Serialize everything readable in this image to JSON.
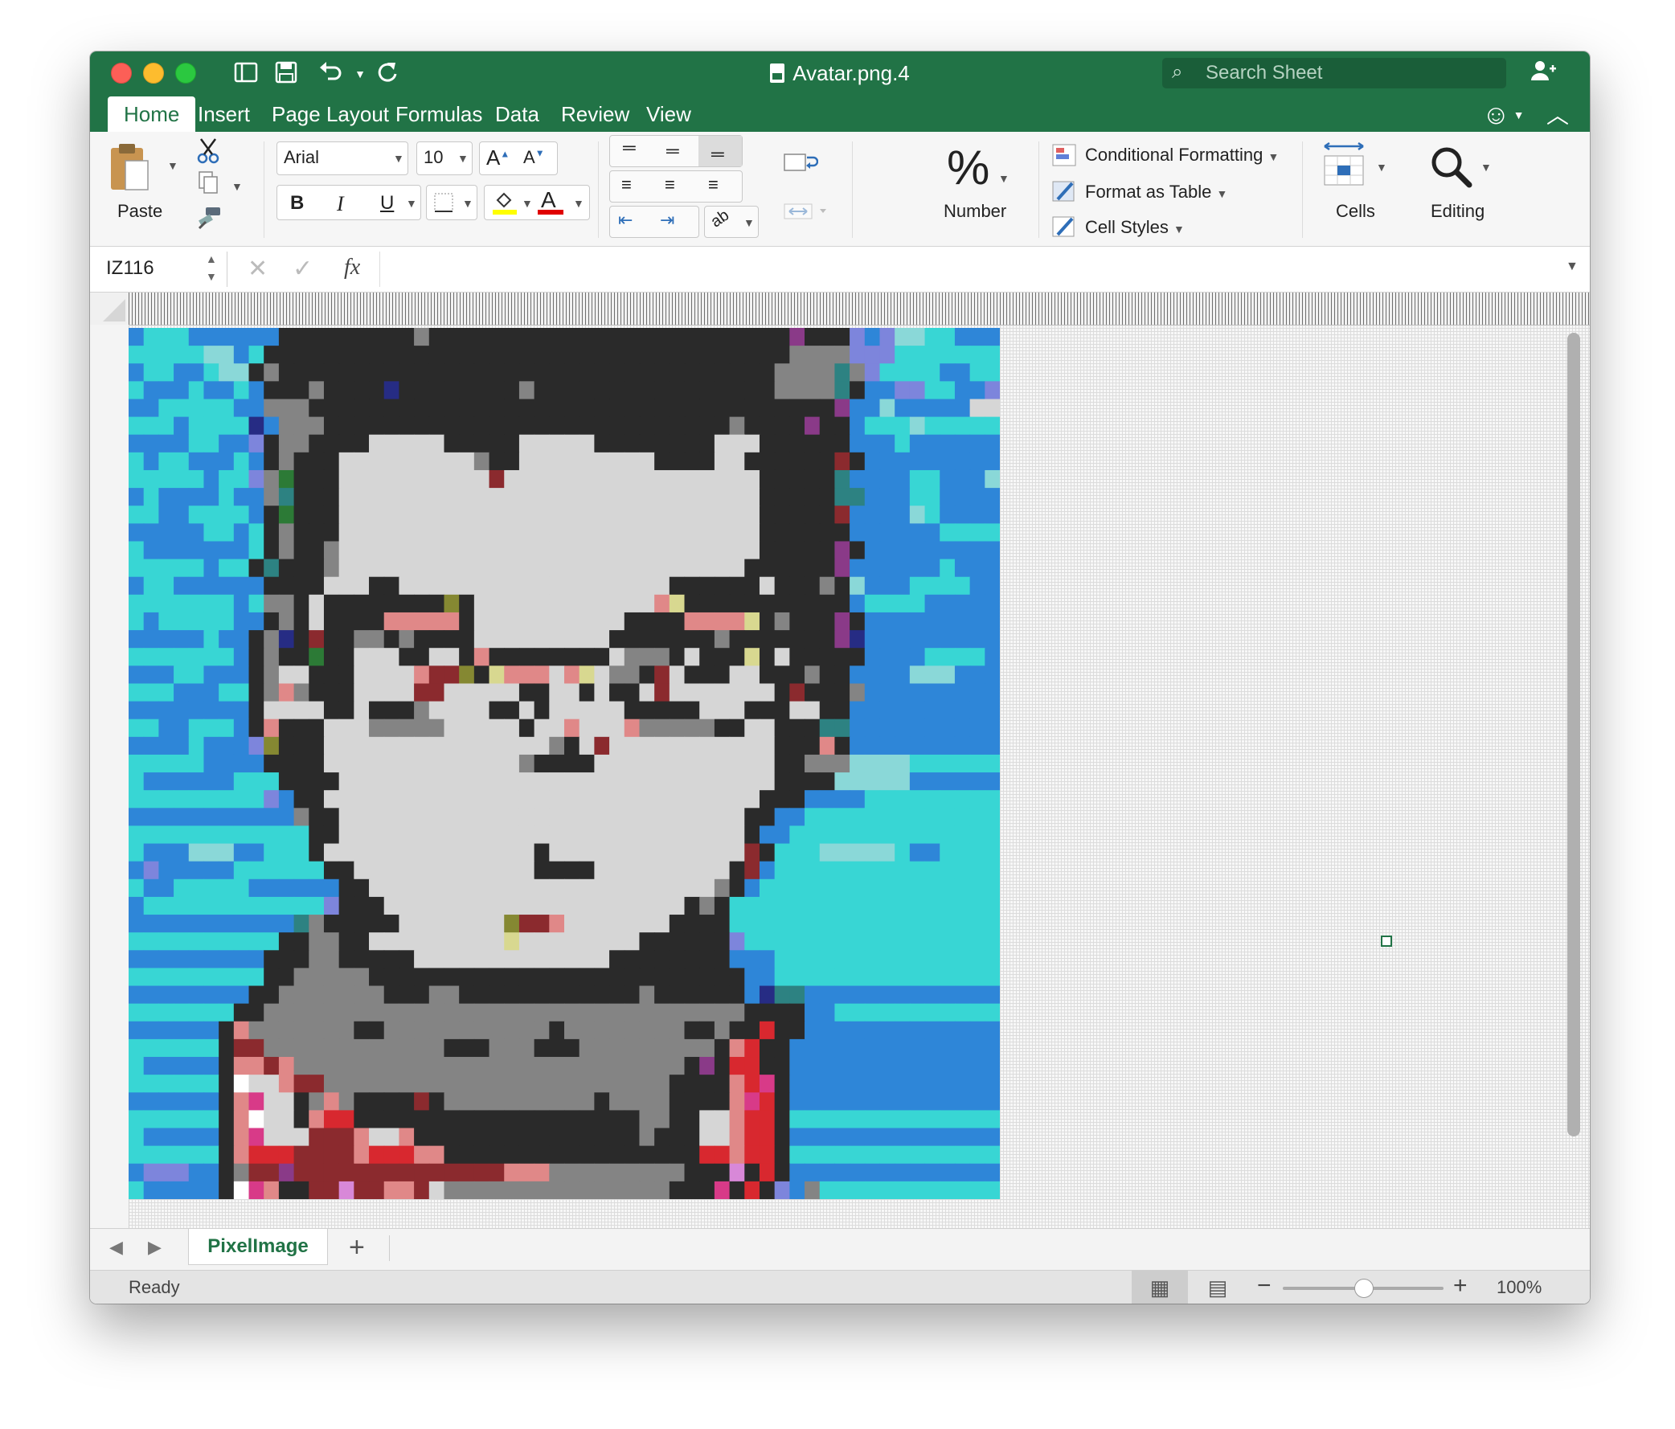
{
  "window": {
    "title": "Avatar.png.4",
    "search_placeholder": "Search Sheet"
  },
  "tabs": [
    "Home",
    "Insert",
    "Page Layout",
    "Formulas",
    "Data",
    "Review",
    "View"
  ],
  "active_tab": "Home",
  "ribbon": {
    "paste_label": "Paste",
    "font_name": "Arial",
    "font_size": "10",
    "bold": "B",
    "italic": "I",
    "underline": "U",
    "grow_font": "A",
    "shrink_font": "A",
    "font_color_glyph": "A",
    "number_label": "Number",
    "number_glyph": "%",
    "conditional_formatting": "Conditional Formatting",
    "format_as_table": "Format as Table",
    "cell_styles": "Cell Styles",
    "cells_label": "Cells",
    "editing_label": "Editing",
    "highlight_color": "#ffff00",
    "font_color": "#e00000"
  },
  "formula_bar": {
    "name_box": "IZ116",
    "fx": "fx",
    "formula": ""
  },
  "sheet_tabs": [
    "PixelImage"
  ],
  "status": {
    "text": "Ready",
    "zoom": "100%",
    "zoom_level": 0.5
  },
  "palette": {
    "a": "#38d6d4",
    "b": "#2e86d8",
    "c": "#8ad8d8",
    "d": "#7d85dc",
    "e": "#ffffff",
    "k": "#2a2a2a",
    "g": "#848484",
    "l": "#d6d6d6",
    "r": "#8b2a2e",
    "p": "#e08888",
    "y": "#d8d890",
    "o": "#858832",
    "t": "#2d8282",
    "n": "#262c84",
    "m": "#8a3a88",
    "v": "#2c7a36",
    "R": "#d8282f",
    "M": "#d83a88",
    "P": "#d888d8"
  },
  "pixel_rows": [
    "baaabbbbbbkkkkkkkkkgkkkkkkkkkkkkkkkkkkkkkkkkmkkkdbdccaabbb",
    "aaaaaccbakkkkkkkkkkkkkkkkkkkkkkkkkkkkkkkkkkkggggdddaaaaaaa",
    "baabbacckgkkkkkkkkkkkkkkkkkkkkkkkkkkkkkkkkkggggtgdaaaabbaa",
    "abbbabbabkkkgkkkknkkkkkkkkgkkkkkkkkkkkkkkkkggggtkbbddaabbd",
    "bbaaaaabbgggkkkkkkkkkkkkkkkkkkkkkkkkkkkkkkkkkkkmbbcbbbbbll",
    "aaabaaaanbgggkkkkkkkkkkkkkkkkkkkkkkkkkkkgkkkkmkkbaaacaaaaa",
    "bbbbaabbdkggkkkklllllkkkkklllllkkkkkkkklllkkkkkkbbbabbbbbb",
    "abaabbbabkgkkklllllllllgkklllllllllkkkkllkkkkkkrkbbbbbbbbb",
    "aaaaabaadgvkkkllllllllllrlllllllllllllllllkkkkktbbbbaabbbc",
    "babbbbabbgtkkkllllllllllllllllllllllllllllkkkkkttbbbaabbbb",
    "aabbaaaabkvkkkllllllllllllllllllllllllllllkkkkkrbbbbcabbbb",
    "bbbbbaabakgkkkllllllllllllllllllllllllllllkkkkkkbbbbbbaaaa",
    "abbbbbbbakgkkgllllllllllllllllllllllllllllkkkkkmkbbbbbbbbb",
    "aaaaabaaktkkkglllllllllllllllllllllllllllkkkkkkmbbbbbbabbb",
    "baabbbbbbkkkklllkkllllllllllllllllllkkkkkklkkkgkcbbbaaaabb",
    "aaaaaaabaggklkkkkkkkkokllllllllllllpykkkkkkkkkkkbaaaabbbbb",
    "abaaaaabbkgklkkkkpppppkllllllllllkkkkppppykgkkkmkbbbbbbbbb",
    "bbbbbabbkgnkrkkggkgkkkklllllllllkkkkkkkgkkkkkkkmnbbbbbbbbb",
    "aaaaaaabkgkkvkklllkkllkpkkkkkkkklgggklkkkyklkkkkkbbbbaaaab",
    "bbbaabbbkgllkkkllllprrokyppplpylggkrlkkkllkkkgkkbbbbcccbbb",
    "aaabbbaakgpgkkkllllrrlllllkkllklkklrlllllllkrkkkgbbbbbbbbb",
    "bbbbbbbbkllllkklkkkgllllkklklllllkkkkklllkkkllkkbbbbbbbbbb",
    "aabbaaabkpkkklllggggglllllkllplllpgggggkkllkkkttbbbbbbbbbb",
    "bbbbabbbdokkklllllllllllllllgklrlllllllllllkkkpkbbbbbbbbbb",
    "aaaaabbbbkkkklllllllllllllgkkkkllllllllllllkkgggccccaaaaaa",
    "abbbbbbaaakkkklllllllllllllllllllllllllllllkkkkcccccbbbbbb",
    "aaaaaaaaadbkklllllllllllllllllllllllllllllkkkbbbbaaaaaaaaa",
    "bbbbbbbbbbbgkklllllllllllllllllllllllllllkkbbaaaaaaaaaaaaa",
    "aaaaaaaaaaaakklllllllllllllllllllllllllllkbbaaaaaaaaaaaaaa",
    "abbbcccbbaaakllllllllllllllklllllllllllllrkaaacccccabbaaaa",
    "bdbbbbbaaaaaakkllllllllllllkkkklllllllllkrbaaaaaaaaaaaaaaa",
    "abbaaaaabbbbbbkklllllllllllllllllllllllgkbaaaaaaaaaaaaaaaa",
    "baaaaaaaaaaaadkkkllllllllllllllllllllkgkaaaaaaaaaaaaaaaaaa",
    "bbbbbbbbbbbtgkkkkklllllllorrplllllllkkkkaaaaaaaaaaaaaaaaaa",
    "aaaaaaaaaakkggkklllllllllyllllllllkkkkkkdaaaaaaaaaaaaaaaaa",
    "bbbbbbbbbkkkggkkkkklllllllllllllkkkkkkkkbbbaaaaaaaaaaaaaaa",
    "aaaaaaaaakkgggggkkkkkkkkkkkkkkkkkkkkkkkkkbbaaaaaaaaaaaaaaa",
    "bbbbbbbbkkgggggggkkkggkkkkkkkkkkkkgkkkkkkbnttbbbbbbbbbbbbb",
    "aaaaaaakkggggggggggggggggggggggggggggggggkkkkbbaaaaaaaaaaa",
    "bbbbbbkpgggggggkkgggggggggggkggggggggkkgkkRkkbbbbbbbbbbbbb",
    "aaaaaakrrggggggggggggkkkgggkkkgggggggggkpRkkbbbbbbbbbbbbbb",
    "abbbbbkpprpggggggggggggggggggggggggggkmkRRkkbbbbbbbbbbbbbb",
    "aaaaaakellprrgggggggggggggggggggggggkkkkpRMkbbbbbbbbbbbbbb",
    "bbbbbbkpMllkgpgkkkkrkggggggggggkggggkkkkpMRkbbbbbbbbbbbbbb",
    "aaaaaakpellkpRRkkkkkkkkkkkkkkkkkkkggkkllpRRkaaaaaaaaaaaaaa",
    "abbbbbkpMlllrrrpllpkkkkkkkkkkkkkkkgkkkllpRRkbbbbbbbbbbbbbb",
    "aaaaaakpRRRrrrrpRRRppkkkkkkkkkkkkkkkkkRRpRRkaaaaaaaaaaaaaa",
    "bdddbbkgrrmrrrrrrrrrrrrrrpppgggggggggkkkPkRkbbbbbbbbbbbbbb",
    "abbbbbkeMpkkrrPrrpprlgggggggggggggggkkkMkRkdbgaaaaaaaaaaaa"
  ]
}
